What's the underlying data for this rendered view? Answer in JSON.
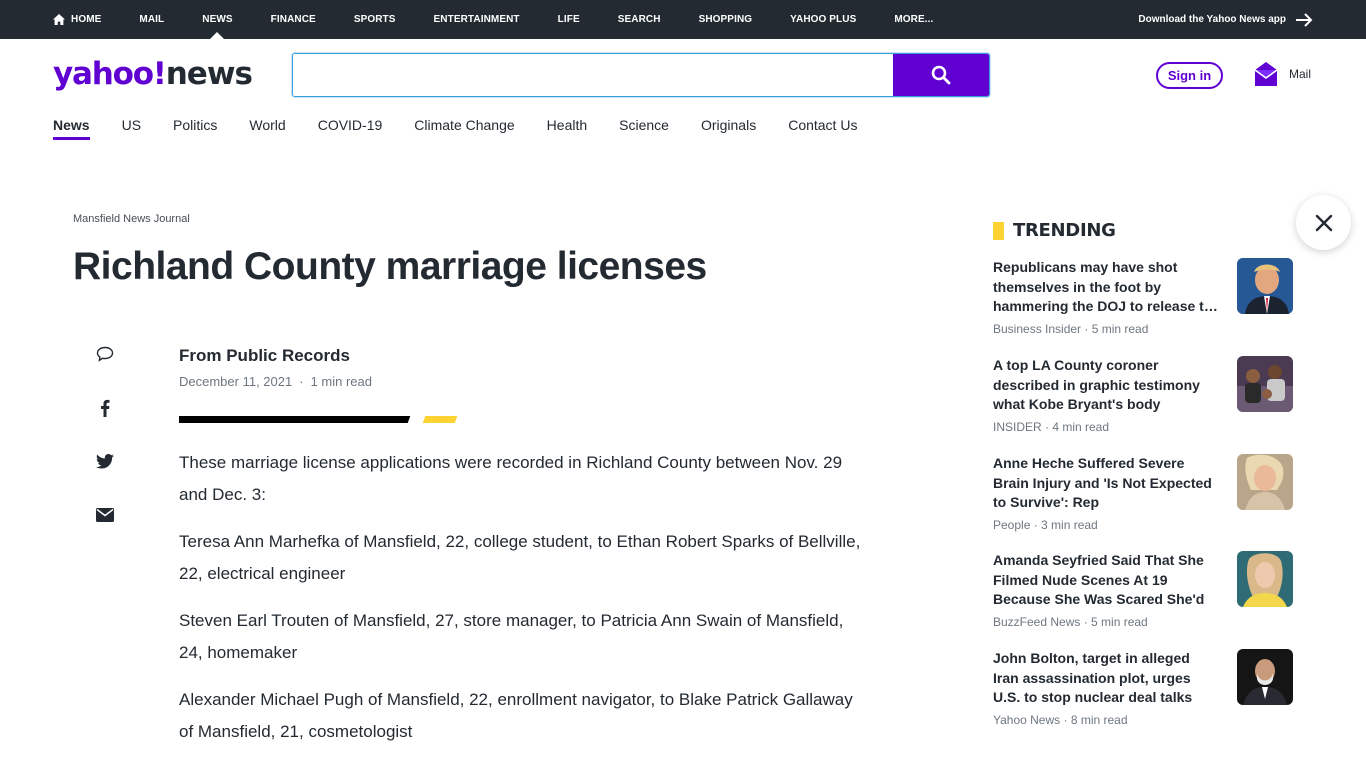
{
  "topbar": {
    "items": [
      {
        "label": "HOME",
        "icon": "home-icon"
      },
      {
        "label": "MAIL"
      },
      {
        "label": "NEWS",
        "active": true
      },
      {
        "label": "FINANCE"
      },
      {
        "label": "SPORTS"
      },
      {
        "label": "ENTERTAINMENT"
      },
      {
        "label": "LIFE"
      },
      {
        "label": "SEARCH"
      },
      {
        "label": "SHOPPING"
      },
      {
        "label": "YAHOO PLUS"
      },
      {
        "label": "MORE..."
      }
    ],
    "download_label": "Download the Yahoo News app"
  },
  "header": {
    "logo_brand": "yahoo!",
    "logo_product": "news",
    "search_value": "",
    "sign_in_label": "Sign in",
    "mail_label": "Mail"
  },
  "section_nav": {
    "items": [
      {
        "label": "News",
        "active": true
      },
      {
        "label": "US"
      },
      {
        "label": "Politics"
      },
      {
        "label": "World"
      },
      {
        "label": "COVID-19"
      },
      {
        "label": "Climate Change"
      },
      {
        "label": "Health"
      },
      {
        "label": "Science"
      },
      {
        "label": "Originals"
      },
      {
        "label": "Contact Us"
      }
    ]
  },
  "article": {
    "provider": "Mansfield News Journal",
    "headline": "Richland County marriage licenses",
    "author": "From Public Records",
    "date": "December 11, 2021",
    "separator": "·",
    "read_time": "1 min read",
    "paragraphs": [
      "These marriage license applications were recorded in Richland County between Nov. 29 and Dec. 3:",
      "Teresa Ann Marhefka of Mansfield, 22, college student, to Ethan Robert Sparks of Bellville, 22, electrical engineer",
      "Steven Earl Trouten of Mansfield, 27, store manager, to Patricia Ann Swain of Mansfield, 24, homemaker",
      "Alexander Michael Pugh of Mansfield, 22, enrollment navigator, to Blake Patrick Gallaway of Mansfield, 21, cosmetologist"
    ]
  },
  "trending": {
    "title": "TRENDING",
    "items": [
      {
        "title": "Republicans may have shot themselves in the foot by hammering the DOJ to release t…",
        "source": "Business Insider · 5 min read"
      },
      {
        "title": "A top LA County coroner described in graphic testimony what Kobe Bryant's body looked…",
        "source": "INSIDER · 4 min read"
      },
      {
        "title": "Anne Heche Suffered Severe Brain Injury and 'Is Not Expected to Survive': Rep",
        "source": "People · 3 min read"
      },
      {
        "title": "Amanda Seyfried Said That She Filmed Nude Scenes At 19 Because She Was Scared She'd Lose Her…",
        "source": "BuzzFeed News · 5 min read"
      },
      {
        "title": "John Bolton, target in alleged Iran assassination plot, urges U.S. to stop nuclear deal talks",
        "source": "Yahoo News · 8 min read"
      }
    ]
  },
  "colors": {
    "brand_purple": "#6001d2",
    "topbar_bg": "#232a31",
    "accent_yellow": "#fdd333",
    "text_dark": "#232a31",
    "text_muted": "#6e7780"
  }
}
